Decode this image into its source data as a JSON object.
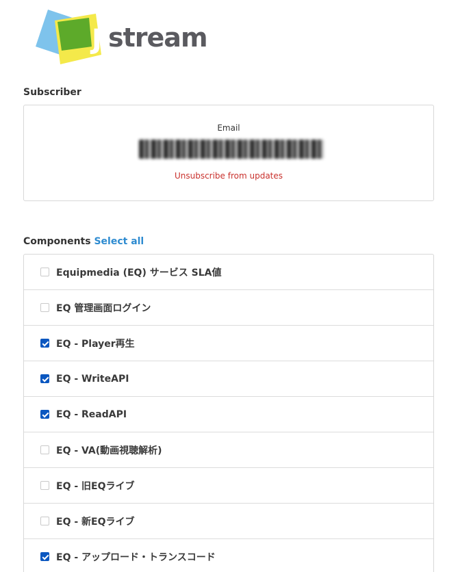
{
  "logo": {
    "text": "stream",
    "letter": "J",
    "colors": {
      "blue": "#7ec3ec",
      "yellow": "#f4e94a",
      "green": "#5daa2a",
      "text": "#5a5a5f"
    }
  },
  "subscriber": {
    "heading": "Subscriber",
    "email_label": "Email",
    "unsubscribe_label": "Unsubscribe from updates"
  },
  "components": {
    "heading": "Components",
    "select_all_label": "Select all",
    "items": [
      {
        "label": "Equipmedia (EQ) サービス SLA値",
        "checked": false
      },
      {
        "label": "EQ 管理画面ログイン",
        "checked": false
      },
      {
        "label": "EQ - Player再生",
        "checked": true
      },
      {
        "label": "EQ - WriteAPI",
        "checked": true
      },
      {
        "label": "EQ - ReadAPI",
        "checked": true
      },
      {
        "label": "EQ - VA(動画視聴解析)",
        "checked": false
      },
      {
        "label": "EQ - 旧EQライブ",
        "checked": false
      },
      {
        "label": "EQ - 新EQライブ",
        "checked": false
      },
      {
        "label": "EQ - アップロード・トランスコード",
        "checked": true
      }
    ]
  },
  "colors": {
    "accent_link": "#2e8bd0",
    "unsubscribe": "#c9302c",
    "checkbox_checked": "#0b57c0"
  }
}
